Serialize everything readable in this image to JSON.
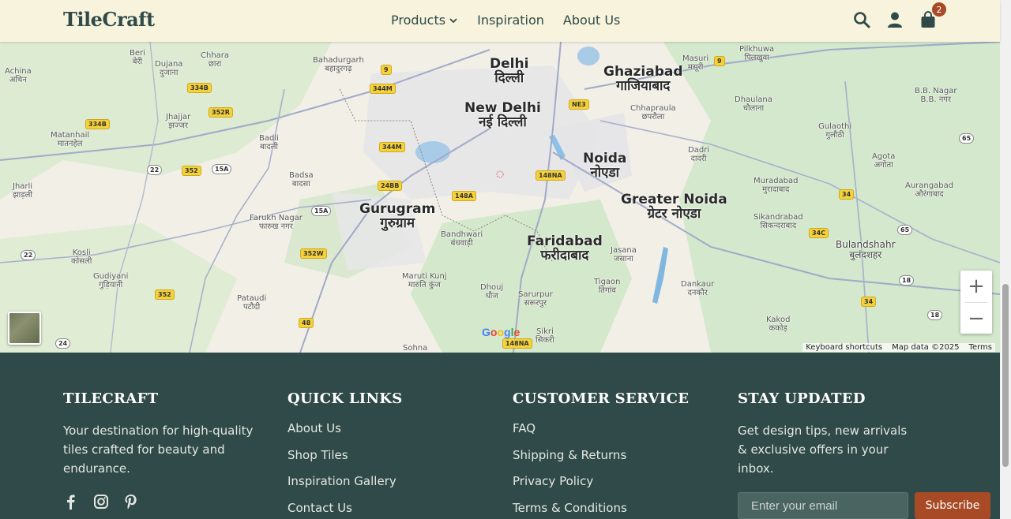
{
  "header": {
    "logo": "TileCraft",
    "nav": [
      {
        "label": "Products",
        "has_dropdown": true
      },
      {
        "label": "Inspiration"
      },
      {
        "label": "About Us"
      }
    ],
    "cart_count": "2"
  },
  "map": {
    "labels": [
      {
        "en": "Delhi",
        "hi": "दिल्ली",
        "size": "big"
      },
      {
        "en": "New Delhi",
        "hi": "नई दिल्ली",
        "size": "big"
      },
      {
        "en": "Ghaziabad",
        "hi": "गाजियाबाद",
        "size": "big"
      },
      {
        "en": "Noida",
        "hi": "नोएडा",
        "size": "big"
      },
      {
        "en": "Greater Noida",
        "hi": "ग्रेटर नोएडा",
        "size": "big"
      },
      {
        "en": "Gurugram",
        "hi": "गुरुग्राम",
        "size": "big"
      },
      {
        "en": "Faridabad",
        "hi": "फरीदाबाद",
        "size": "big"
      },
      {
        "en": "Bulandshahr",
        "hi": "बुलंदशहर",
        "size": "med"
      },
      {
        "en": "Bahadurgarh",
        "hi": "बहादुरगढ़",
        "size": "sm"
      },
      {
        "en": "Jhajjar",
        "hi": "झज्जर",
        "size": "sm"
      },
      {
        "en": "Badli",
        "hi": "बादली",
        "size": "sm"
      },
      {
        "en": "Badsa",
        "hi": "बादसा",
        "size": "sm"
      },
      {
        "en": "Farukh Nagar",
        "hi": "फारुख नगर",
        "size": "sm"
      },
      {
        "en": "Pataudi",
        "hi": "पटौदी",
        "size": "sm"
      },
      {
        "en": "Bandhwari",
        "hi": "बंधवाड़ी",
        "size": "sm"
      },
      {
        "en": "Maruti Kunj",
        "hi": "मारुति कुंज",
        "size": "sm"
      },
      {
        "en": "Dhouj",
        "hi": "धौज",
        "size": "sm"
      },
      {
        "en": "Sarurpur",
        "hi": "सरूरपुर",
        "size": "sm"
      },
      {
        "en": "Jasana",
        "hi": "जसाना",
        "size": "sm"
      },
      {
        "en": "Tigaon",
        "hi": "तिगांव",
        "size": "sm"
      },
      {
        "en": "Dankaur",
        "hi": "दनकौर",
        "size": "sm"
      },
      {
        "en": "Dadri",
        "hi": "दादरी",
        "size": "sm"
      },
      {
        "en": "Chhapraula",
        "hi": "छपरौला",
        "size": "sm"
      },
      {
        "en": "Masuri",
        "hi": "मसूरी",
        "size": "sm"
      },
      {
        "en": "Pilkhuwa",
        "hi": "पिलखुवा",
        "size": "sm"
      },
      {
        "en": "Dhaulana",
        "hi": "धौलाना",
        "size": "sm"
      },
      {
        "en": "Gulaothi",
        "hi": "गुलौठी",
        "size": "sm"
      },
      {
        "en": "Agota",
        "hi": "अगोता",
        "size": "sm"
      },
      {
        "en": "Muradabad",
        "hi": "मुरादाबाद",
        "size": "sm"
      },
      {
        "en": "Sikandrabad",
        "hi": "सिकन्दराबाद",
        "size": "sm"
      },
      {
        "en": "Aurangabad",
        "hi": "औरंगाबाद",
        "size": "sm"
      },
      {
        "en": "B.B. Nagar",
        "hi": "B.B. नगर",
        "size": "sm"
      },
      {
        "en": "Kakod",
        "hi": "ककोड़",
        "size": "sm"
      },
      {
        "en": "Beri",
        "hi": "बेरी",
        "size": "sm"
      },
      {
        "en": "Dujana",
        "hi": "दुजाना",
        "size": "sm"
      },
      {
        "en": "Chhara",
        "hi": "छारा",
        "size": "sm"
      },
      {
        "en": "Achina",
        "hi": "अचिन",
        "size": "sm"
      },
      {
        "en": "Matanhail",
        "hi": "मातनहेल",
        "size": "sm"
      },
      {
        "en": "Jharli",
        "hi": "झाड़ली",
        "size": "sm"
      },
      {
        "en": "Kosli",
        "hi": "कोसली",
        "size": "sm"
      },
      {
        "en": "Gudiyani",
        "hi": "गुड़ियानी",
        "size": "sm"
      },
      {
        "en": "Sikri",
        "hi": "सिकरी",
        "size": "sm"
      },
      {
        "en": "Sohna",
        "hi": "",
        "size": "sm"
      }
    ],
    "shields": [
      "9",
      "344M",
      "344M",
      "NE3",
      "334B",
      "352R",
      "334B",
      "344M",
      "24BB",
      "148A",
      "148NA",
      "22",
      "352",
      "15A",
      "15A",
      "352W",
      "352",
      "48",
      "24",
      "22",
      "148NA",
      "9",
      "65",
      "34",
      "34C",
      "65",
      "18",
      "34",
      "18"
    ],
    "keyboard_shortcuts": "Keyboard shortcuts",
    "map_data": "Map data ©2025",
    "terms": "Terms",
    "google": "Google",
    "zoom_in": "+",
    "zoom_out": "−"
  },
  "footer": {
    "brand": {
      "heading": "TILECRAFT",
      "text": "Your destination for high-quality tiles crafted for beauty and endurance.",
      "social": [
        "facebook-icon",
        "instagram-icon",
        "pinterest-icon"
      ]
    },
    "quick_links": {
      "heading": "QUICK LINKS",
      "items": [
        "About Us",
        "Shop Tiles",
        "Inspiration Gallery",
        "Contact Us"
      ]
    },
    "customer_service": {
      "heading": "CUSTOMER SERVICE",
      "items": [
        "FAQ",
        "Shipping & Returns",
        "Privacy Policy",
        "Terms & Conditions"
      ]
    },
    "newsletter": {
      "heading": "STAY UPDATED",
      "text": "Get design tips, new arrivals & exclusive offers in your inbox.",
      "placeholder": "Enter your email",
      "button": "Subscribe"
    }
  },
  "colors": {
    "header_bg": "#f7f3dd",
    "brand": "#2f4a48",
    "accent": "#a84a26"
  }
}
